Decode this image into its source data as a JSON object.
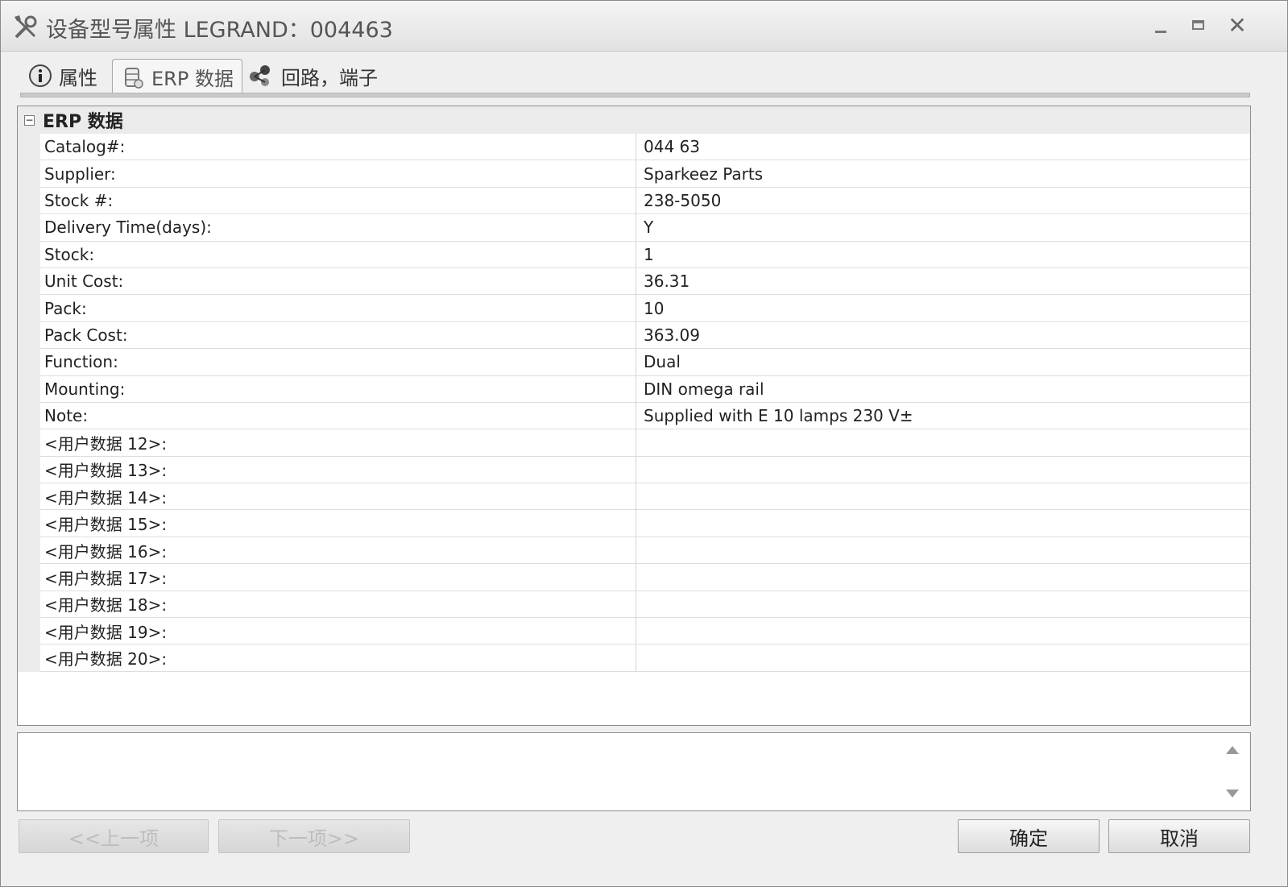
{
  "window": {
    "title": "设备型号属性 LEGRAND：004463",
    "controls": {
      "minimize": "–",
      "close": "✕"
    }
  },
  "tabs": [
    {
      "label": "属性",
      "icon": "info-icon"
    },
    {
      "label": "ERP 数据",
      "icon": "database-icon"
    },
    {
      "label": "回路，端子",
      "icon": "nodes-icon"
    }
  ],
  "grid": {
    "group_title": "ERP 数据",
    "collapse_glyph": "−",
    "rows": [
      {
        "label": "Catalog#:",
        "value": "044 63"
      },
      {
        "label": "Supplier:",
        "value": "Sparkeez Parts"
      },
      {
        "label": "Stock #:",
        "value": "238-5050"
      },
      {
        "label": "Delivery Time(days):",
        "value": "Y"
      },
      {
        "label": "Stock:",
        "value": "1"
      },
      {
        "label": "Unit Cost:",
        "value": "36.31"
      },
      {
        "label": "Pack:",
        "value": "10"
      },
      {
        "label": "Pack Cost:",
        "value": "363.09"
      },
      {
        "label": "Function:",
        "value": "Dual"
      },
      {
        "label": "Mounting:",
        "value": "DIN omega rail"
      },
      {
        "label": "Note:",
        "value": "Supplied with E 10 lamps 230 V±"
      },
      {
        "label": "<用户数据 12>:",
        "value": ""
      },
      {
        "label": "<用户数据 13>:",
        "value": ""
      },
      {
        "label": "<用户数据 14>:",
        "value": ""
      },
      {
        "label": "<用户数据 15>:",
        "value": ""
      },
      {
        "label": "<用户数据 16>:",
        "value": ""
      },
      {
        "label": "<用户数据 17>:",
        "value": ""
      },
      {
        "label": "<用户数据 18>:",
        "value": ""
      },
      {
        "label": "<用户数据 19>:",
        "value": ""
      },
      {
        "label": "<用户数据 20>:",
        "value": ""
      }
    ]
  },
  "buttons": {
    "prev": "<<上一项",
    "next": "下一项>>",
    "ok": "确定",
    "cancel": "取消"
  }
}
